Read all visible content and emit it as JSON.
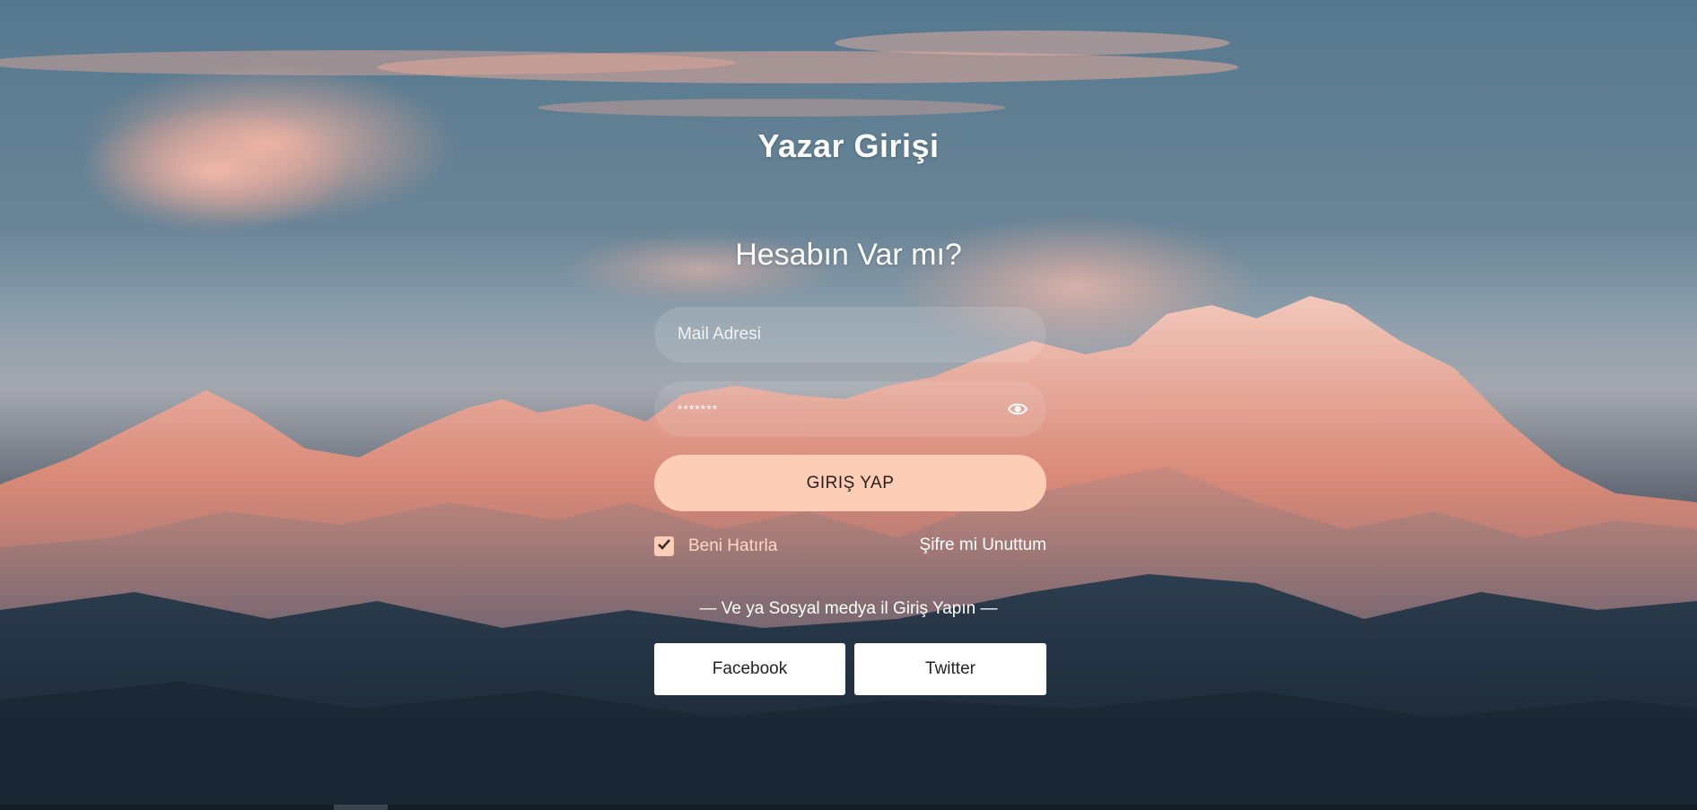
{
  "page": {
    "title": "Yazar Girişi",
    "subtitle": "Hesabın Var mı?"
  },
  "form": {
    "email_placeholder": "Mail Adresi",
    "password_value": "*******",
    "login_label": "GIRIŞ YAP",
    "remember_label": "Beni Hatırla",
    "remember_checked": true,
    "forgot_label": "Şifre mi Unuttum"
  },
  "social": {
    "divider_text": "— Ve ya Sosyal medya il Giriş Yapın —",
    "facebook_label": "Facebook",
    "twitter_label": "Twitter"
  },
  "icons": {
    "password_toggle": "eye-icon",
    "remember_check": "check-icon"
  },
  "colors": {
    "accent": "#fdcdb6",
    "button_text": "#2a1e1a",
    "social_bg": "#ffffff"
  }
}
